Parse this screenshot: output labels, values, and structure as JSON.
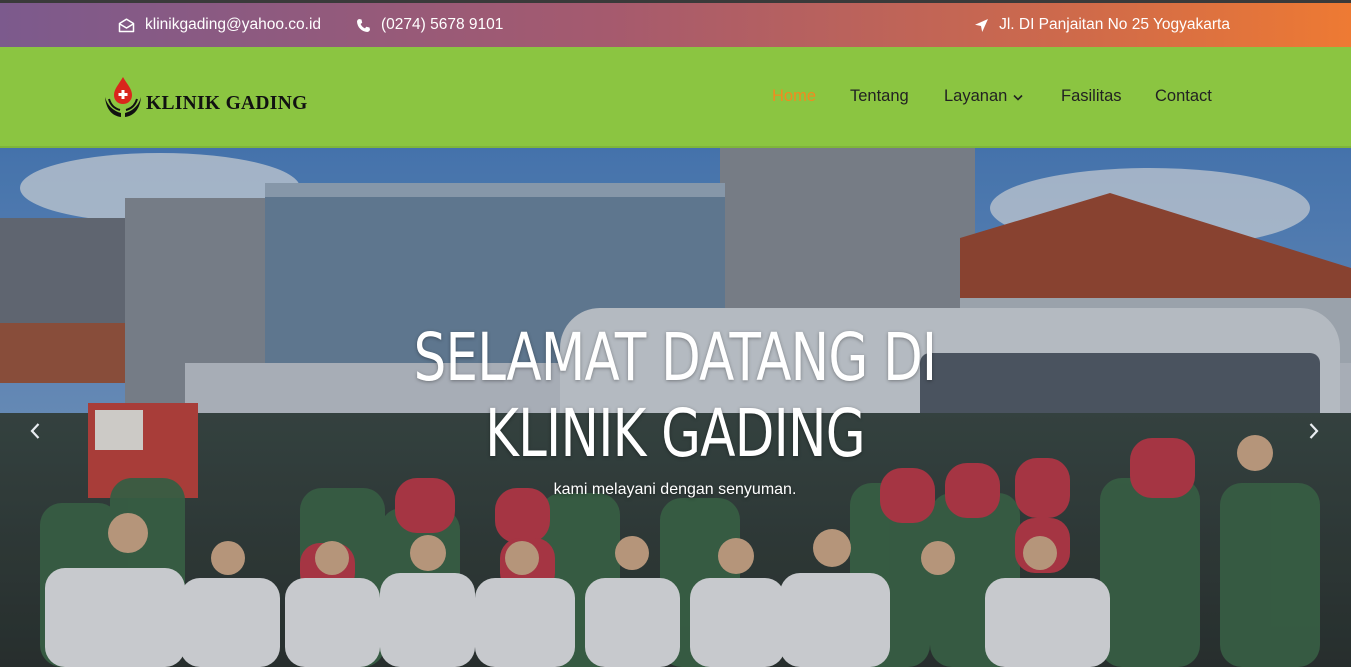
{
  "topbar": {
    "email": "klinikgading@yahoo.co.id",
    "phone": "(0274) 5678 9101",
    "address": "Jl. DI Panjaitan No 25 Yogyakarta",
    "icons": {
      "email": "envelope-icon",
      "phone": "phone-icon",
      "address": "location-arrow-icon"
    }
  },
  "brand": {
    "name": "KLINIK GADING",
    "logo_icon": "blood-drop-hands-icon"
  },
  "nav": {
    "items": [
      {
        "label": "Home",
        "active": true
      },
      {
        "label": "Tentang"
      },
      {
        "label": "Layanan",
        "has_dropdown": true
      },
      {
        "label": "Fasilitas"
      },
      {
        "label": "Contact"
      }
    ]
  },
  "hero": {
    "title_line1": "SELAMAT DATANG DI",
    "title_line2": "KLINIK GADING",
    "subtitle": "kami melayani dengan senyuman."
  },
  "colors": {
    "topbar_gradient_start": "#7c5a8d",
    "topbar_gradient_end": "#ee7a33",
    "navbar_bg": "#8bc541",
    "nav_active": "#f28a1f",
    "nav_text": "#222222"
  }
}
